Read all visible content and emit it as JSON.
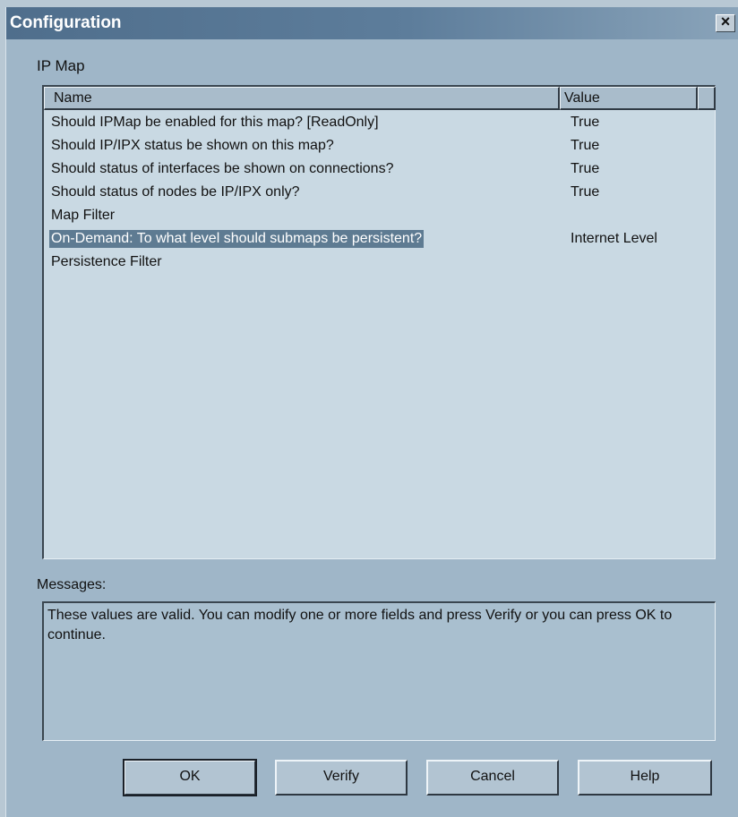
{
  "window": {
    "title": "Configuration",
    "close_glyph": "×",
    "close_icon": "close-icon"
  },
  "group": {
    "label": "IP Map"
  },
  "list": {
    "columns": [
      "Name",
      "Value"
    ],
    "rows": [
      {
        "name": "Should IPMap be enabled for this map? [ReadOnly]",
        "value": "True",
        "selected": false
      },
      {
        "name": "Should IP/IPX status be shown on this map?",
        "value": "True",
        "selected": false
      },
      {
        "name": "Should status of interfaces be shown on connections?",
        "value": "True",
        "selected": false
      },
      {
        "name": "Should status of nodes be IP/IPX only?",
        "value": "True",
        "selected": false
      },
      {
        "name": "Map Filter",
        "value": "",
        "selected": false
      },
      {
        "name": "On-Demand: To what level should submaps be persistent?",
        "value": "Internet Level",
        "selected": true
      },
      {
        "name": "Persistence Filter",
        "value": "",
        "selected": false
      }
    ]
  },
  "messages": {
    "label": "Messages:",
    "text": "These values are valid.  You can modify one or more fields and press Verify or you can press OK to continue."
  },
  "buttons": {
    "ok": "OK",
    "verify": "Verify",
    "cancel": "Cancel",
    "help": "Help"
  },
  "colors": {
    "dialog_bg": "#9fb6c8",
    "titlebar": "#4f6e8c",
    "list_bg": "#c9d9e3",
    "selection": "#5e7b92"
  }
}
